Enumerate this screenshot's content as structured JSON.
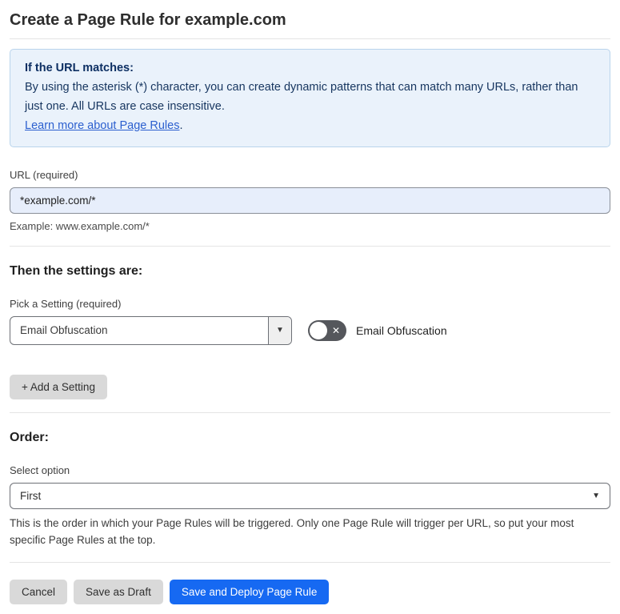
{
  "page": {
    "title": "Create a Page Rule for example.com"
  },
  "info_box": {
    "heading": "If the URL matches:",
    "body": "By using the asterisk (*) character, you can create dynamic patterns that can match many URLs, rather than just one. All URLs are case insensitive.",
    "link_label": "Learn more about Page Rules",
    "link_suffix": "."
  },
  "url_section": {
    "label": "URL (required)",
    "value": "*example.com/*",
    "example": "Example: www.example.com/*"
  },
  "settings_section": {
    "heading": "Then the settings are:",
    "picker_label": "Pick a Setting (required)",
    "selected_setting": "Email Obfuscation",
    "toggle_label": "Email Obfuscation",
    "toggle_state": "off",
    "add_setting_label": "+ Add a Setting"
  },
  "order_section": {
    "heading": "Order:",
    "select_label": "Select option",
    "selected_option": "First",
    "description": "This is the order in which your Page Rules will be triggered. Only one Page Rule will trigger per URL, so put your most specific Page Rules at the top."
  },
  "footer": {
    "cancel_label": "Cancel",
    "save_draft_label": "Save as Draft",
    "save_deploy_label": "Save and Deploy Page Rule"
  },
  "icons": {
    "dropdown_caret": "▼",
    "select_caret": "▼",
    "toggle_off_x": "✕"
  },
  "colors": {
    "accent_blue": "#1669F2",
    "info_bg": "#EAF2FB",
    "info_border": "#B9D4EC",
    "info_text": "#16355F",
    "link_blue": "#2B5FCF",
    "input_bg": "#E7EEFB",
    "toggle_off_bg": "#55575C",
    "gray_button_bg": "#D9D9D9"
  }
}
